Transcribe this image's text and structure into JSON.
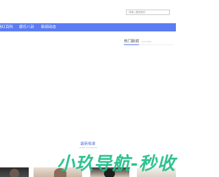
{
  "search": {
    "placeholder": "请输入要搜索的"
  },
  "nav": {
    "items": [
      {
        "label": "网红百科"
      },
      {
        "label": "娱乐八卦"
      },
      {
        "label": "新闻动态"
      }
    ]
  },
  "hot": {
    "title": "热门新闻",
    "subtitle": "HOT NEWS"
  },
  "latest": {
    "title": "最新收录",
    "subtitle": "LATEST COLLECTION"
  },
  "watermark": {
    "text": "小玖导航-秒收"
  },
  "colors": {
    "nav_bg": "#5b7cf2",
    "accent": "#4a6be0",
    "watermark": "#24c08a"
  }
}
